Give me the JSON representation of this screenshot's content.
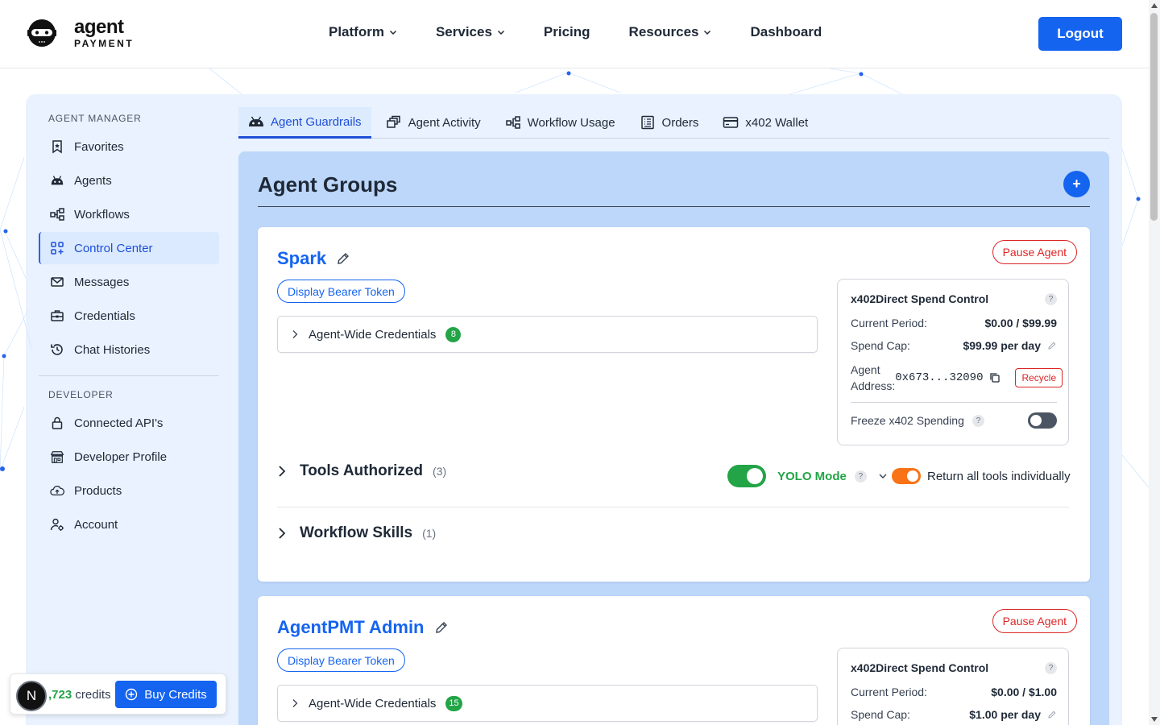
{
  "brand": {
    "line1": "agent",
    "line2": "PAYMENT"
  },
  "nav": {
    "items": [
      {
        "label": "Platform",
        "dropdown": true
      },
      {
        "label": "Services",
        "dropdown": true
      },
      {
        "label": "Pricing",
        "dropdown": false
      },
      {
        "label": "Resources",
        "dropdown": true
      },
      {
        "label": "Dashboard",
        "dropdown": false
      }
    ],
    "logout_label": "Logout"
  },
  "sidebar": {
    "section1": "AGENT MANAGER",
    "items1": [
      {
        "label": "Favorites",
        "icon": "bookmark-icon"
      },
      {
        "label": "Agents",
        "icon": "robot-icon"
      },
      {
        "label": "Workflows",
        "icon": "workflow-icon"
      },
      {
        "label": "Control Center",
        "icon": "grid-plus-icon",
        "active": true
      },
      {
        "label": "Messages",
        "icon": "envelope-icon"
      },
      {
        "label": "Credentials",
        "icon": "briefcase-icon"
      },
      {
        "label": "Chat Histories",
        "icon": "history-icon"
      }
    ],
    "section2": "DEVELOPER",
    "items2": [
      {
        "label": "Connected API's",
        "icon": "lock-icon"
      },
      {
        "label": "Developer Profile",
        "icon": "storefront-icon"
      },
      {
        "label": "Products",
        "icon": "cloud-upload-icon"
      },
      {
        "label": "Account",
        "icon": "user-gear-icon"
      }
    ]
  },
  "tabs": [
    {
      "label": "Agent Guardrails",
      "icon": "robot-icon",
      "active": true
    },
    {
      "label": "Agent Activity",
      "icon": "activity-icon"
    },
    {
      "label": "Workflow Usage",
      "icon": "workflow-icon"
    },
    {
      "label": "Orders",
      "icon": "receipt-icon"
    },
    {
      "label": "x402 Wallet",
      "icon": "wallet-icon"
    }
  ],
  "main": {
    "title": "Agent Groups",
    "add_label": "+"
  },
  "agents": [
    {
      "name": "Spark",
      "pause_label": "Pause Agent",
      "bearer_label": "Display Bearer Token",
      "credentials_label": "Agent-Wide Credentials",
      "credentials_count": "8",
      "spend": {
        "title": "x402Direct Spend Control",
        "period_label": "Current Period:",
        "period_value": "$0.00 / $99.99",
        "cap_label": "Spend Cap:",
        "cap_value": "$99.99 per day",
        "address_label": "Agent Address:",
        "address_value": "0x673...32090",
        "recycle_label": "Recycle",
        "freeze_label": "Freeze x402 Spending"
      },
      "tools_title": "Tools Authorized",
      "tools_count": "(3)",
      "yolo_label": "YOLO Mode",
      "return_label": "Return all tools individually",
      "skills_title": "Workflow Skills",
      "skills_count": "(1)"
    },
    {
      "name": "AgentPMT Admin",
      "pause_label": "Pause Agent",
      "bearer_label": "Display Bearer Token",
      "credentials_label": "Agent-Wide Credentials",
      "credentials_count": "15",
      "spend": {
        "title": "x402Direct Spend Control",
        "period_label": "Current Period:",
        "period_value": "$0.00 / $1.00",
        "cap_label": "Spend Cap:",
        "cap_value": "$1.00 per day"
      }
    }
  ],
  "credits": {
    "avatar_letter": "N",
    "amount": ",723",
    "suffix": "credits",
    "buy_label": "Buy Credits"
  },
  "colors": {
    "primary": "#1464f0",
    "danger": "#dc2626",
    "success": "#22a447",
    "warning": "#f97316"
  }
}
